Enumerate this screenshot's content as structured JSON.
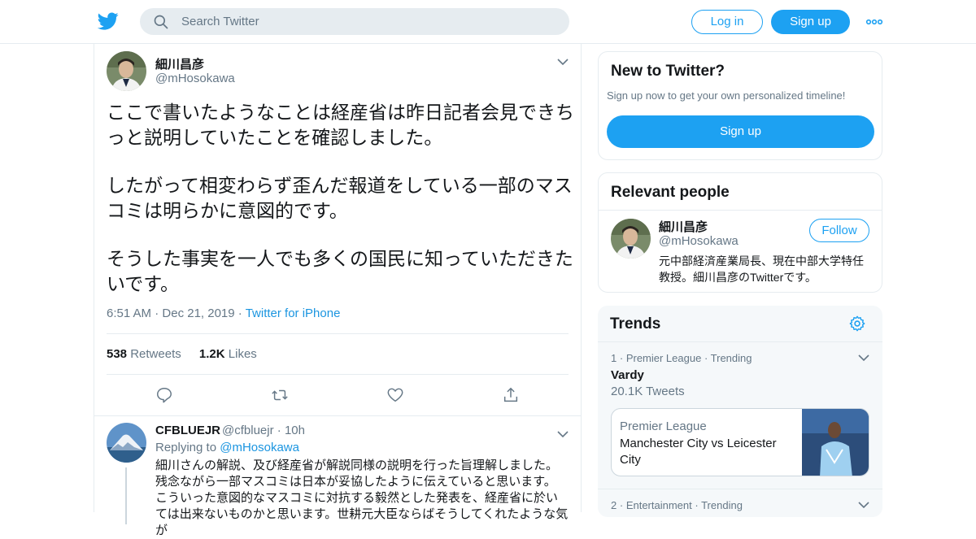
{
  "header": {
    "search_placeholder": "Search Twitter",
    "login_label": "Log in",
    "signup_label": "Sign up"
  },
  "tweet": {
    "author_name": "細川昌彦",
    "author_handle": "@mHosokawa",
    "paragraphs": [
      "ここで書いたようなことは経産省は昨日記者会見できちっと説明していたことを確認しました。",
      "したがって相変わらず歪んだ報道をしている一部のマスコミは明らかに意図的です。",
      "そうした事実を一人でも多くの国民に知っていただきたいです。"
    ],
    "time": "6:51 AM",
    "date": "Dec 21, 2019",
    "source": "Twitter for iPhone",
    "retweets_count": "538",
    "retweets_label": "Retweets",
    "likes_count": "1.2K",
    "likes_label": "Likes"
  },
  "reply": {
    "author_name": "CFBLUEJR",
    "author_handle": "@cfbluejr",
    "age": "10h",
    "replying_prefix": "Replying to",
    "replying_to": "@mHosokawa",
    "lines": [
      "細川さんの解説、及び経産省が解説同様の説明を行った旨理解しました。",
      "残念ながら一部マスコミは日本が妥協したように伝えていると思います。",
      "こういった意図的なマスコミに対抗する毅然とした発表を、経産省に於い",
      "ては出来ないものかと思います。世耕元大臣ならばそうしてくれたような気が"
    ]
  },
  "sidebar": {
    "new_title": "New to Twitter?",
    "new_sub": "Sign up now to get your own personalized timeline!",
    "new_signup": "Sign up",
    "relevant_title": "Relevant people",
    "person_name": "細川昌彦",
    "person_handle": "@mHosokawa",
    "person_bio": "元中部経済産業局長、現在中部大学特任教授。細川昌彦のTwitterです。",
    "follow_label": "Follow",
    "trends_title": "Trends",
    "trend1": {
      "rank": "1",
      "category": "Premier League",
      "status": "Trending",
      "name": "Vardy",
      "count": "20.1K Tweets",
      "news_category": "Premier League",
      "news_title": "Manchester City vs Leicester City"
    },
    "trend2": {
      "rank": "2",
      "category": "Entertainment",
      "status": "Trending"
    }
  },
  "colors": {
    "accent": "#1da1f2",
    "link": "#1b95e0",
    "secondary_text": "#657786",
    "border": "#e6ecf0"
  },
  "icons": [
    "twitter-bird-icon",
    "search-icon",
    "more-icon",
    "chevron-down-icon",
    "reply-icon",
    "retweet-icon",
    "like-icon",
    "share-icon",
    "gear-icon"
  ]
}
